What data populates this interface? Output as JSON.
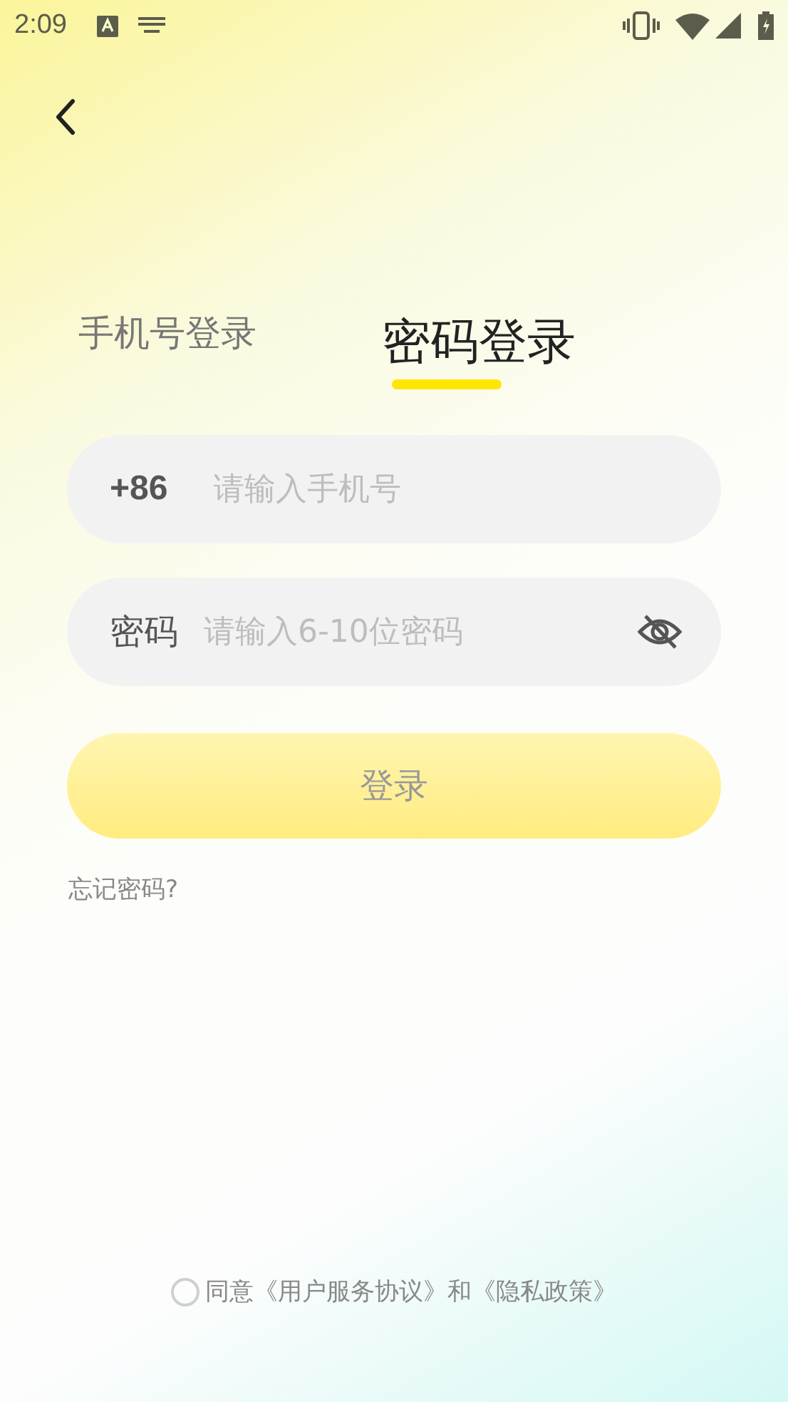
{
  "status_bar": {
    "time": "2:09"
  },
  "tabs": [
    {
      "label": "手机号登录",
      "selected": false
    },
    {
      "label": "密码登录",
      "selected": true
    }
  ],
  "phone_field": {
    "prefix": "+86",
    "placeholder": "请输入手机号"
  },
  "password_field": {
    "label": "密码",
    "placeholder": "请输入6-10位密码",
    "password_visible": false
  },
  "login_button": {
    "label": "登录",
    "disabled": true
  },
  "forgot_link": "忘记密码?",
  "agreement": {
    "checked": false,
    "text": "同意《用户服务协议》和《隐私政策》"
  }
}
